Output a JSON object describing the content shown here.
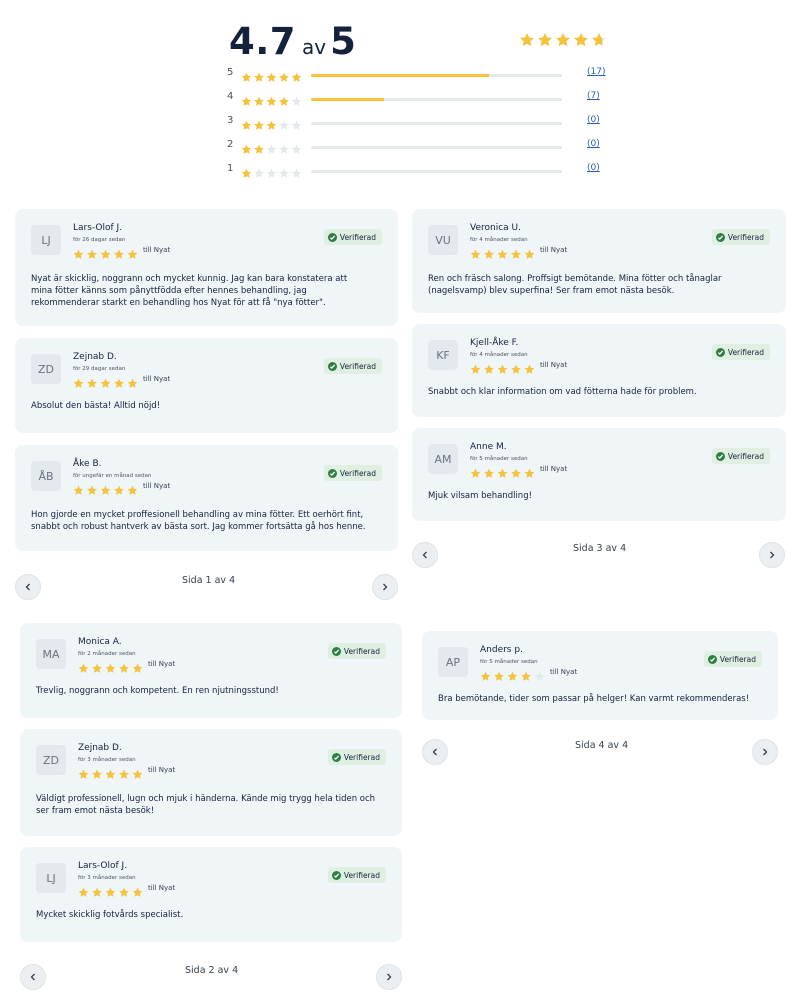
{
  "summary": {
    "rating": "4.7",
    "of": "av",
    "max": "5",
    "rating_value": 4.7,
    "distribution": [
      {
        "stars": "5",
        "count_text": "(17)",
        "fraction": 0.71,
        "filled": 5
      },
      {
        "stars": "4",
        "count_text": "(7)",
        "fraction": 0.29,
        "filled": 4
      },
      {
        "stars": "3",
        "count_text": "(0)",
        "fraction": 0,
        "filled": 3
      },
      {
        "stars": "2",
        "count_text": "(0)",
        "fraction": 0,
        "filled": 2
      },
      {
        "stars": "1",
        "count_text": "(0)",
        "fraction": 0,
        "filled": 1
      }
    ]
  },
  "verified_label": "Verifierad",
  "colors": {
    "star": "#f5c23c",
    "star_empty": "#e3e9ed",
    "verified": "#2f7d46",
    "link": "#2b5fb3"
  },
  "panels": [
    {
      "page_label": "Sida 1 av 4",
      "reviews": [
        {
          "initials": "LJ",
          "name": "Lars-Olof J.",
          "time": "för 26 dagar sedan",
          "stars": 5,
          "target": "till Nyat",
          "text": [
            "Nyat är skicklig, noggrann och mycket kunnig. Jag kan bara konstatera att",
            "mina fötter känns som pånyttfödda efter hennes behandling, jag",
            "rekommenderar starkt en behandling hos Nyat för att få \"nya fötter\"."
          ]
        },
        {
          "initials": "ZD",
          "name": "Zejnab D.",
          "time": "för 29 dagar sedan",
          "stars": 5,
          "target": "till Nyat",
          "text": [
            "Absolut den bästa! Alltid nöjd!"
          ]
        },
        {
          "initials": "ÅB",
          "name": "Åke B.",
          "time": "för ungefär en månad sedan",
          "stars": 5,
          "target": "till Nyat",
          "text": [
            "Hon gjorde en mycket proffesionell behandling av mina fötter. Ett oerhört fint,",
            "snabbt och robust hantverk av bästa sort. Jag kommer fortsätta gå hos henne."
          ]
        }
      ]
    },
    {
      "page_label": "Sida 3 av 4",
      "reviews": [
        {
          "initials": "VU",
          "name": "Veronica U.",
          "time": "för 4 månader sedan",
          "stars": 5,
          "target": "till Nyat",
          "text": [
            "Ren och fräsch salong. Proffsigt bemötande. Mina fötter och tånaglar",
            "(nagelsvamp) blev superfina! Ser fram emot nästa besök."
          ]
        },
        {
          "initials": "KF",
          "name": "Kjell-Åke F.",
          "time": "för 4 månader sedan",
          "stars": 5,
          "target": "till Nyat",
          "text": [
            "Snabbt och klar information om vad fötterna hade för problem."
          ]
        },
        {
          "initials": "AM",
          "name": "Anne M.",
          "time": "för 5 månader sedan",
          "stars": 5,
          "target": "till Nyat",
          "text": [
            "Mjuk vilsam behandling!"
          ]
        }
      ]
    },
    {
      "page_label": "Sida 2 av 4",
      "reviews": [
        {
          "initials": "MA",
          "name": "Monica A.",
          "time": "för 2 månader sedan",
          "stars": 5,
          "target": "till Nyat",
          "text": [
            "Trevlig, noggrann och kompetent. En ren njutningsstund!"
          ]
        },
        {
          "initials": "ZD",
          "name": "Zejnab D.",
          "time": "för 3 månader sedan",
          "stars": 5,
          "target": "till Nyat",
          "text": [
            "Väldigt professionell, lugn och mjuk i händerna. Kände mig trygg hela tiden och",
            "ser fram emot nästa besök!"
          ]
        },
        {
          "initials": "LJ",
          "name": "Lars-Olof J.",
          "time": "för 3 månader sedan",
          "stars": 5,
          "target": "till Nyat",
          "text": [
            "Mycket skicklig fotvårds specialist."
          ]
        }
      ]
    },
    {
      "page_label": "Sida 4 av 4",
      "reviews": [
        {
          "initials": "AP",
          "name": "Anders p.",
          "time": "för 5 månader sedan",
          "stars": 4,
          "target": "till Nyat",
          "text": [
            "Bra bemötande, tider som passar på helger! Kan varmt rekommenderas!"
          ]
        }
      ]
    }
  ]
}
